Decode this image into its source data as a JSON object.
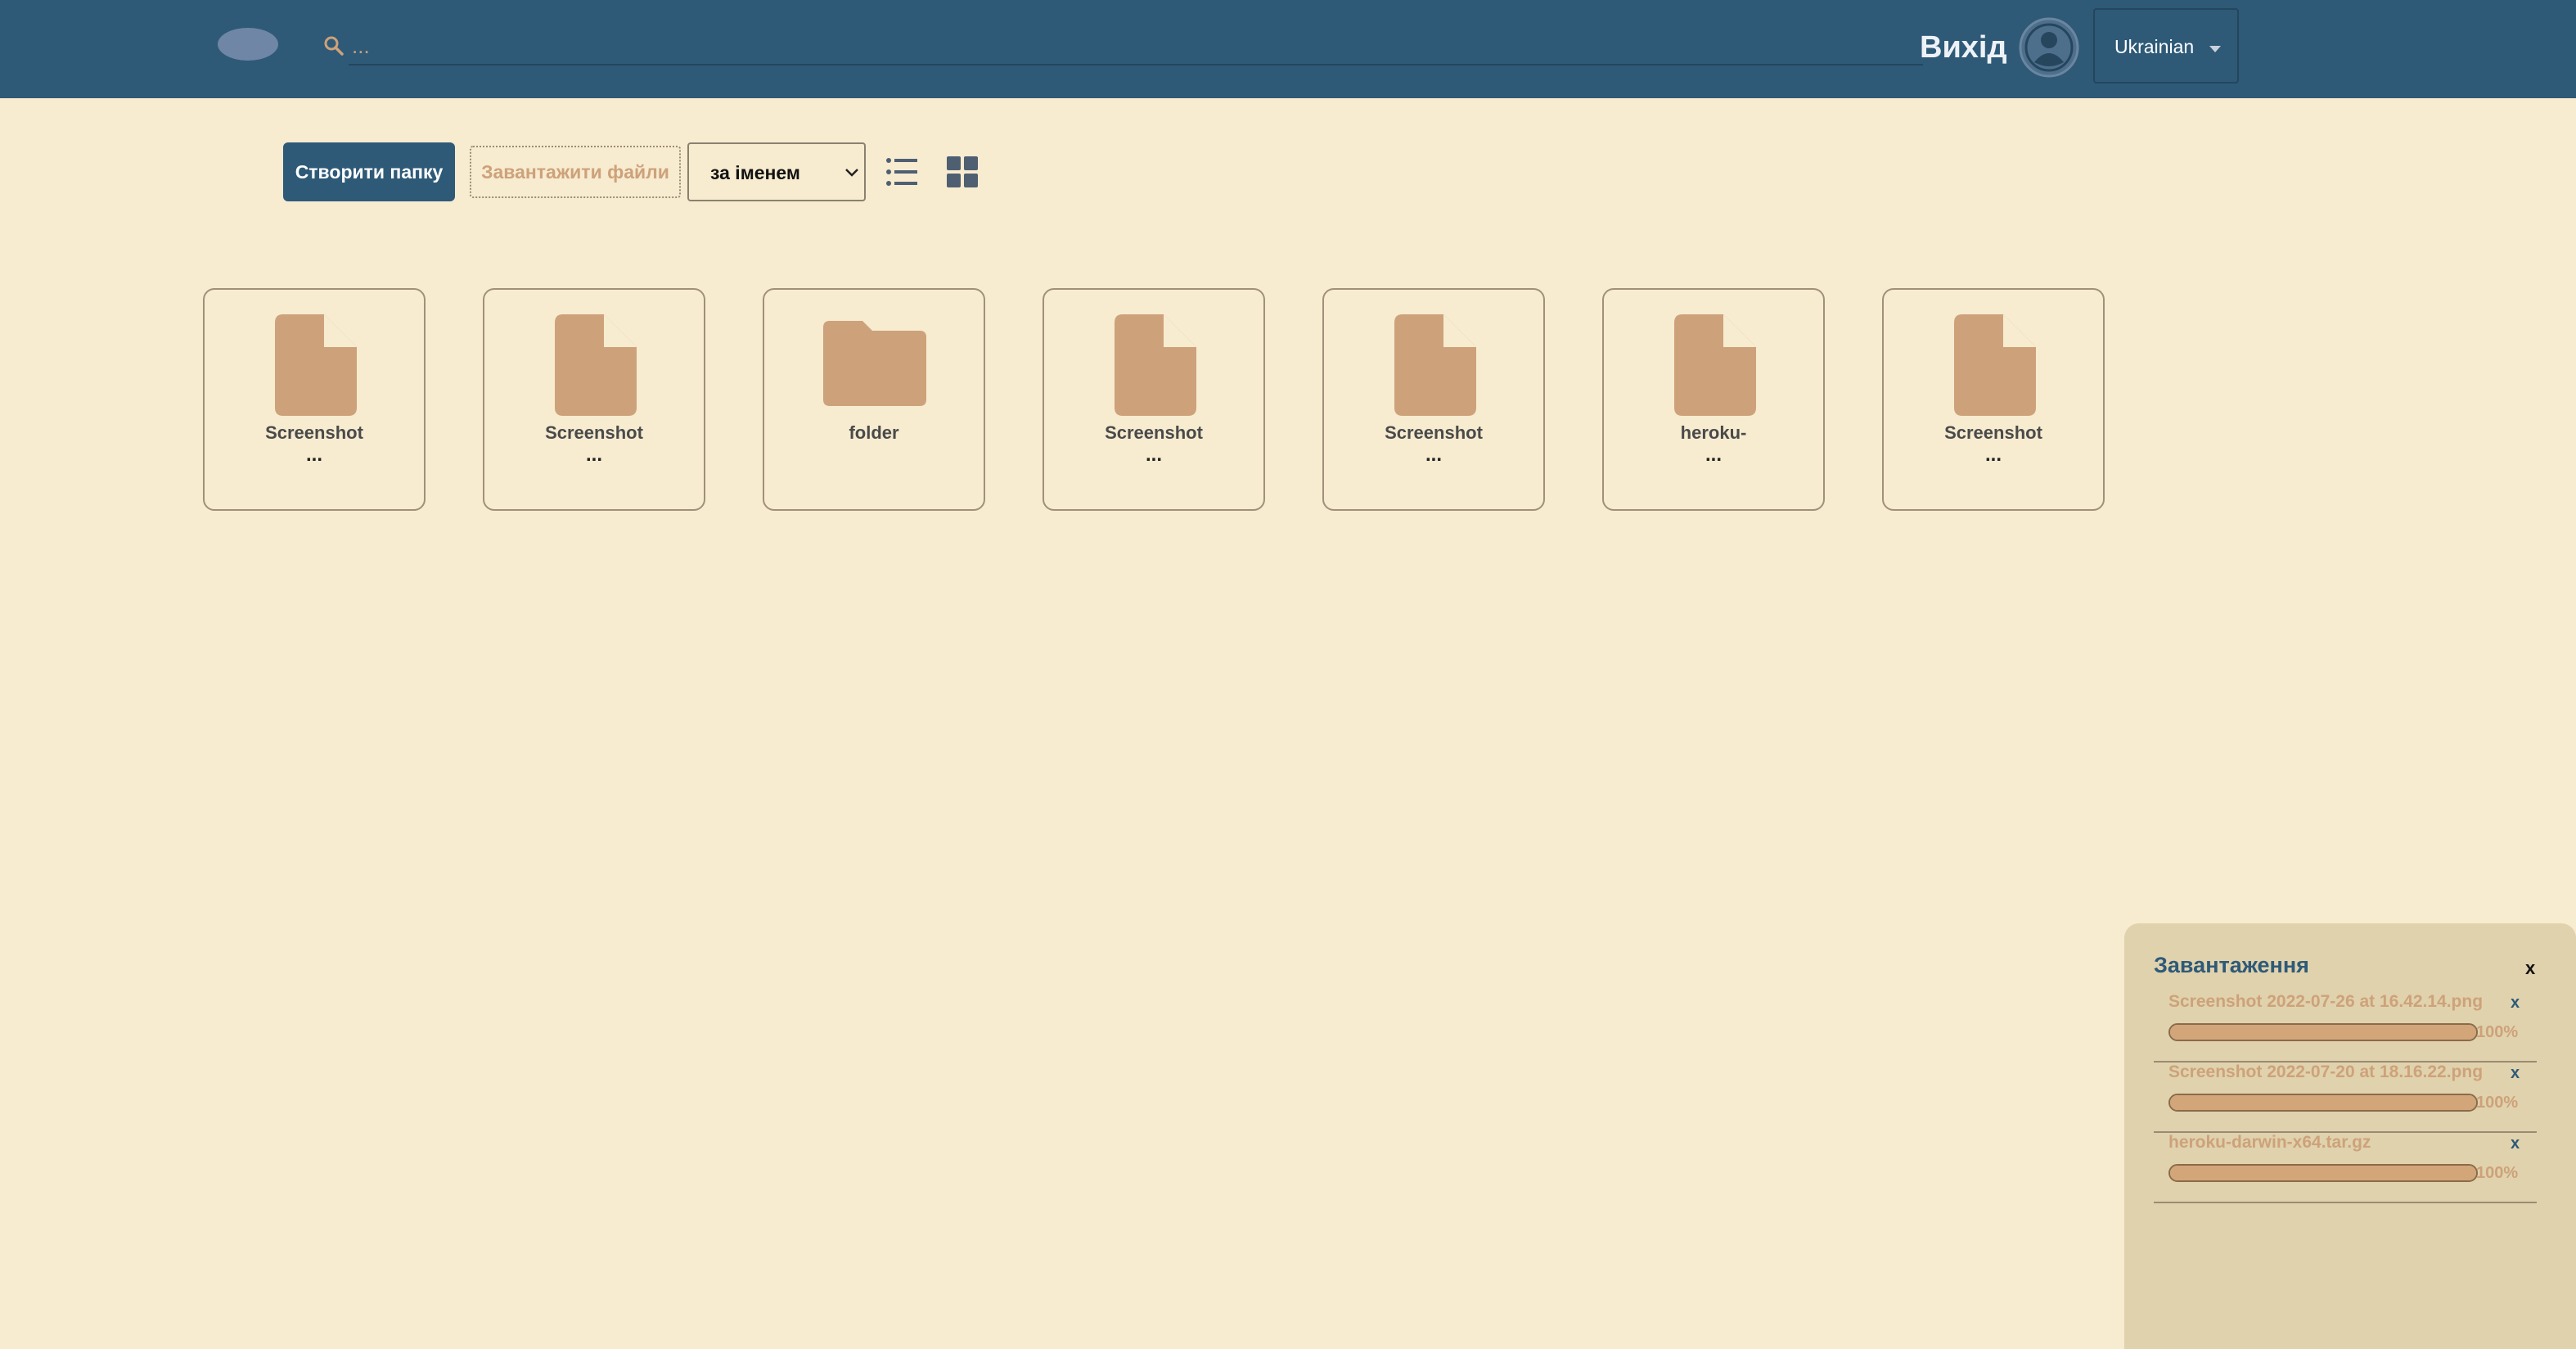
{
  "header": {
    "search_placeholder": "...",
    "logout_label": "Вихід",
    "language": "Ukrainian"
  },
  "toolbar": {
    "create_folder_label": "Створити папку",
    "upload_files_label": "Завантажити файли",
    "sort_selected": "за іменем"
  },
  "files": [
    {
      "name": "Screenshot",
      "more": "...",
      "type": "file"
    },
    {
      "name": "Screenshot",
      "more": "...",
      "type": "file"
    },
    {
      "name": "folder",
      "more": "",
      "type": "folder"
    },
    {
      "name": "Screenshot",
      "more": "...",
      "type": "file"
    },
    {
      "name": "Screenshot",
      "more": "...",
      "type": "file"
    },
    {
      "name": "heroku-",
      "more": "...",
      "type": "file"
    },
    {
      "name": "Screenshot",
      "more": "...",
      "type": "file"
    }
  ],
  "uploads": {
    "title": "Завантаження",
    "close_label": "x",
    "items": [
      {
        "name": "Screenshot 2022-07-26 at 16.42.14.png",
        "percent": "100%",
        "progress": 1.0,
        "remove_label": "x"
      },
      {
        "name": "Screenshot 2022-07-20 at 18.16.22.png",
        "percent": "100%",
        "progress": 1.0,
        "remove_label": "x"
      },
      {
        "name": "heroku-darwin-x64.tar.gz",
        "percent": "100%",
        "progress": 1.0,
        "remove_label": "x"
      }
    ]
  },
  "colors": {
    "header_bg": "#2e5a78",
    "page_bg": "#f7ebd0",
    "icon_fill": "#cda27a",
    "uploads_bg": "#e0d2ad"
  },
  "icons": {
    "search": "search-icon",
    "avatar": "user-avatar-icon",
    "list_view": "list-view-icon",
    "grid_view": "grid-view-icon",
    "file": "file-icon",
    "folder": "folder-icon"
  }
}
